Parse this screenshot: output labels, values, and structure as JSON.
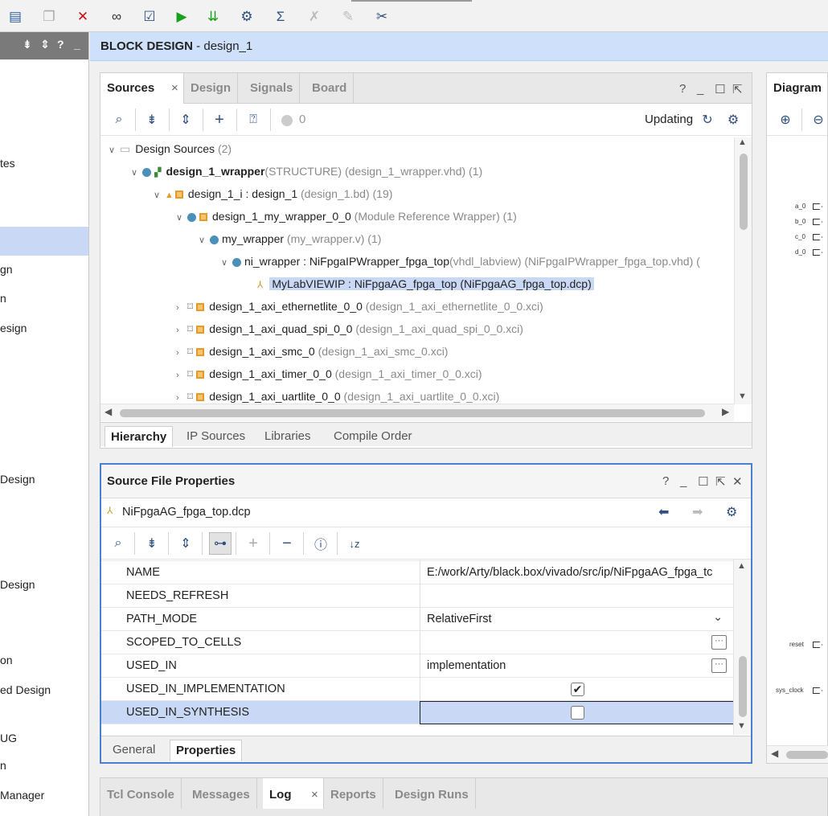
{
  "toolbar": {
    "icons": [
      "report-icon",
      "copy-icon",
      "delete-icon",
      "find-icon",
      "validate-icon",
      "run-icon",
      "program-icon",
      "settings-icon",
      "sum-icon",
      "disabled-a-icon",
      "disabled-b-icon",
      "disabled-c-icon"
    ]
  },
  "left_panel": {
    "items": [
      {
        "label": "tes"
      },
      {
        "label": "gn"
      },
      {
        "label": "n"
      },
      {
        "label": "esign"
      },
      {
        "label": "Design"
      },
      {
        "label": " Design"
      },
      {
        "label": "on"
      },
      {
        "label": "ed Design"
      },
      {
        "label": "UG"
      },
      {
        "label": "n"
      },
      {
        "label": "Manager"
      }
    ]
  },
  "header": {
    "title_bold": "BLOCK DESIGN",
    "title_rest": " - design_1"
  },
  "sources": {
    "tabs": [
      "Sources",
      "Design",
      "Signals",
      "Board"
    ],
    "status": "Updating",
    "count": "0",
    "tree": [
      {
        "name": "Design Sources",
        "detail": " (2)"
      },
      {
        "name": "design_1_wrapper",
        "detail": "(STRUCTURE) (design_1_wrapper.vhd) (1)"
      },
      {
        "name": "design_1_i : design_1",
        "detail": " (design_1.bd) (19)"
      },
      {
        "name": "design_1_my_wrapper_0_0",
        "detail": " (Module Reference Wrapper) (1)"
      },
      {
        "name": "my_wrapper",
        "detail": " (my_wrapper.v) (1)"
      },
      {
        "name": "ni_wrapper : NiFpgaIPWrapper_fpga_top",
        "detail": "(vhdl_labview) (NiFpgaIPWrapper_fpga_top.vhd) ("
      },
      {
        "name": "MyLabVIEWIP : NiFpgaAG_fpga_top (NiFpgaAG_fpga_top.dcp)",
        "detail": ""
      },
      {
        "name": "design_1_axi_ethernetlite_0_0",
        "detail": " (design_1_axi_ethernetlite_0_0.xci)"
      },
      {
        "name": "design_1_axi_quad_spi_0_0",
        "detail": " (design_1_axi_quad_spi_0_0.xci)"
      },
      {
        "name": "design_1_axi_smc_0",
        "detail": " (design_1_axi_smc_0.xci)"
      },
      {
        "name": "design_1_axi_timer_0_0",
        "detail": " (design_1_axi_timer_0_0.xci)"
      },
      {
        "name": "design_1_axi_uartlite_0_0",
        "detail": " (design_1_axi_uartlite_0_0.xci)"
      }
    ],
    "bottom_tabs": [
      "Hierarchy",
      "IP Sources",
      "Libraries",
      "Compile Order"
    ]
  },
  "props": {
    "title": "Source File Properties",
    "file": "NiFpgaAG_fpga_top.dcp",
    "rows": [
      {
        "name": "NAME",
        "value": "E:/work/Arty/black.box/vivado/src/ip/NiFpgaAG_fpga_tc"
      },
      {
        "name": "NEEDS_REFRESH",
        "value": ""
      },
      {
        "name": "PATH_MODE",
        "value": "RelativeFirst"
      },
      {
        "name": "SCOPED_TO_CELLS",
        "value": ""
      },
      {
        "name": "USED_IN",
        "value": "implementation"
      },
      {
        "name": "USED_IN_IMPLEMENTATION",
        "value": ""
      },
      {
        "name": "USED_IN_SYNTHESIS",
        "value": ""
      }
    ],
    "checked_impl": true,
    "checked_synth": false,
    "bottom_tabs": [
      "General",
      "Properties"
    ]
  },
  "diagram": {
    "title": "Diagram",
    "ports": [
      "a_0",
      "b_0",
      "c_0",
      "d_0",
      "reset",
      "sys_clock"
    ]
  },
  "bottom": {
    "tabs": [
      "Tcl Console",
      "Messages",
      "Log",
      "Reports",
      "Design Runs"
    ]
  },
  "colors": {
    "accent": "#4b7fd0",
    "header_bg": "#cfe0fb",
    "selection": "#c9d9f5"
  }
}
